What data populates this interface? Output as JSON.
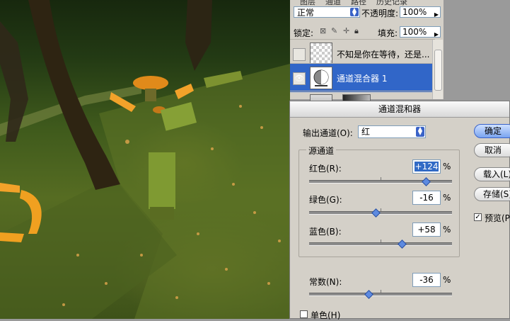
{
  "layers_panel": {
    "tabs": [
      "图层",
      "通道",
      "路径",
      "历史记录"
    ],
    "blend_mode": "正常",
    "opacity_label": "不透明度:",
    "opacity_value": "100%",
    "lock_label": "锁定:",
    "fill_label": "填充:",
    "fill_value": "100%",
    "layers": [
      {
        "name": "不知是你在等待，还是...",
        "visible": false,
        "thumb": "checker"
      },
      {
        "name": "通道混合器 1",
        "visible": true,
        "thumb": "mask",
        "active": true
      },
      {
        "name": "",
        "visible": false,
        "thumb": "gradient"
      }
    ]
  },
  "dialog": {
    "title": "通道混和器",
    "output_label": "输出通道(O):",
    "output_value": "红",
    "source_group_label": "源通道",
    "channels": [
      {
        "label": "红色(R):",
        "value": "+124",
        "percent": 124,
        "selected": true
      },
      {
        "label": "绿色(G):",
        "value": "-16",
        "percent": -16
      },
      {
        "label": "蓝色(B):",
        "value": "+58",
        "percent": 58
      }
    ],
    "constant": {
      "label": "常数(N):",
      "value": "-36",
      "percent": -36
    },
    "percent_sign": "%",
    "buttons": {
      "ok": "确定",
      "cancel": "取消",
      "load": "载入(L)",
      "save": "存储(S)"
    },
    "preview_label": "预览(P)",
    "preview_checked": true,
    "mono_label": "单色(H)",
    "mono_checked": false
  },
  "colors": {
    "accent": "#3166c8",
    "dialog_bg": "#d4d0c8",
    "bench": "#f0a020"
  }
}
